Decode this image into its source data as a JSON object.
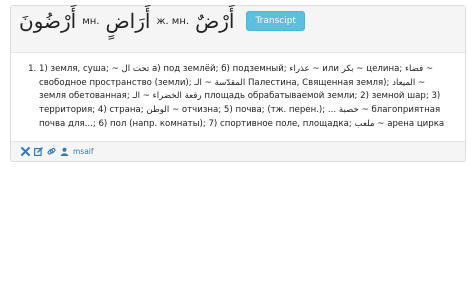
{
  "entry": {
    "plural2": "أَرْضُونَ",
    "plural2_abbr": "мн.",
    "plural1": "أَرَاضٍ",
    "plural1_abbr": "ж. мн.",
    "headword": "أَرْضٌ",
    "translit_label": "Transcipt"
  },
  "definition": "1) земля, суша; ~ تحت ال а) под землёй; б) подземный; عذراء ~ или بكر ~ целина; فضاء ~ свободное пространство (земли); المقدّسة ~ الـ Палестина, Священная земля); الميعاد ~ земля обетованная; رقعة الخضراء ~ الـ площадь обрабатываемой земли; 2) земной шар; 3) территория; 4) страна; الوطن ~ отчизна; 5) почва; (тж. перен.); ... خصبة ~ благоприятная почва для...; 6) пол (напр. комнаты); 7) спортивное поле, площадка; ملعب ~ арена цирка",
  "footer": {
    "author": "msaif",
    "icons": [
      "close-icon",
      "edit-icon",
      "link-icon",
      "user-icon"
    ],
    "colors": {
      "accent": "#337ab7",
      "button": "#5bc0de"
    }
  }
}
